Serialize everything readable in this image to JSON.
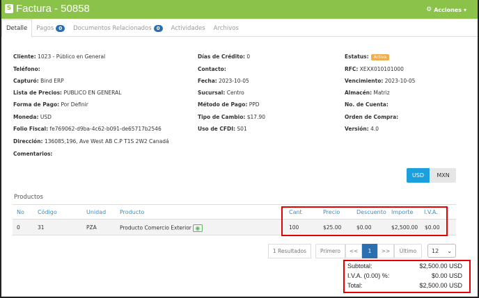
{
  "header": {
    "title": "Factura - 50858",
    "logo_letter": "S",
    "actions_label": "Acciones",
    "gear_icon": "gear-icon",
    "color": "#8bc34a"
  },
  "tabs": [
    {
      "label": "Detalle",
      "badge": ""
    },
    {
      "label": "Pagos",
      "badge": "0"
    },
    {
      "label": "Documentos Relacionados",
      "badge": "0"
    },
    {
      "label": "Actividades",
      "badge": ""
    },
    {
      "label": "Archivos",
      "badge": ""
    }
  ],
  "details": {
    "cliente": {
      "label": "Cliente:",
      "value": "1023 - Público en General"
    },
    "telefono": {
      "label": "Teléfono:",
      "value": ""
    },
    "capturo": {
      "label": "Capturó:",
      "value": "Bind ERP"
    },
    "lista_precios": {
      "label": "Lista de Precios:",
      "value": "PUBLICO EN GENERAL"
    },
    "forma_pago": {
      "label": "Forma de Pago:",
      "value": "Por Definir"
    },
    "moneda": {
      "label": "Moneda:",
      "value": "USD"
    },
    "folio_fiscal": {
      "label": "Folio Fiscal:",
      "value": "fe769062-d9ba-4c62-b091-de65717b2546"
    },
    "direccion": {
      "label": "Dirección:",
      "value": "136085,196, Ave West AB C.P T1S 2W2 Canadá"
    },
    "comentarios": {
      "label": "Comentarios:",
      "value": ""
    },
    "dias_credito": {
      "label": "Días de Crédito:",
      "value": "0"
    },
    "contacto": {
      "label": "Contacto:",
      "value": ""
    },
    "fecha": {
      "label": "Fecha:",
      "value": "2023-10-05"
    },
    "sucursal": {
      "label": "Sucursal:",
      "value": "Centro"
    },
    "metodo_pago": {
      "label": "Método de Pago:",
      "value": "PPD"
    },
    "tipo_cambio": {
      "label": "Tipo de Cambio:",
      "value": "$17.90"
    },
    "uso_cfdi": {
      "label": "Uso de CFDI:",
      "value": "S01"
    },
    "estatus": {
      "label": "Estatus:",
      "value": "Activa"
    },
    "rfc": {
      "label": "RFC:",
      "value": "XEXX010101000"
    },
    "vencimiento": {
      "label": "Vencimiento:",
      "value": "2023-10-05"
    },
    "almacen": {
      "label": "Almacén:",
      "value": "Matriz"
    },
    "no_cuenta": {
      "label": "No. de Cuenta:",
      "value": ""
    },
    "orden_compra": {
      "label": "Orden de Compra:",
      "value": ""
    },
    "version": {
      "label": "Versión:",
      "value": "4.0"
    }
  },
  "currency": {
    "usd": "USD",
    "mxn": "MXN",
    "selected": "USD"
  },
  "products": {
    "title": "Productos",
    "columns": [
      "No",
      "Código",
      "Unidad",
      "Producto",
      "Cant",
      "Precio",
      "Descuento",
      "Importe",
      "I.V.A."
    ],
    "rows": [
      {
        "no": "0",
        "codigo": "31",
        "unidad": "PZA",
        "producto": "Producto Comercio Exterior",
        "cant": "100",
        "precio": "$25.00",
        "descuento": "$0.00",
        "importe": "$2,500.00",
        "iva": "$0.00"
      }
    ]
  },
  "pagination": {
    "results": "1 Resultados",
    "first": "Primero",
    "prev": "<<",
    "current": "1",
    "next": ">>",
    "last": "Último",
    "page_size": "12"
  },
  "totals": {
    "subtotal_label": "Subtotal:",
    "subtotal": "$2,500.00 USD",
    "iva_label": "I.V.A. (0.00) %:",
    "iva": "$0.00 USD",
    "total_label": "Total:",
    "total": "$2,500.00 USD"
  }
}
